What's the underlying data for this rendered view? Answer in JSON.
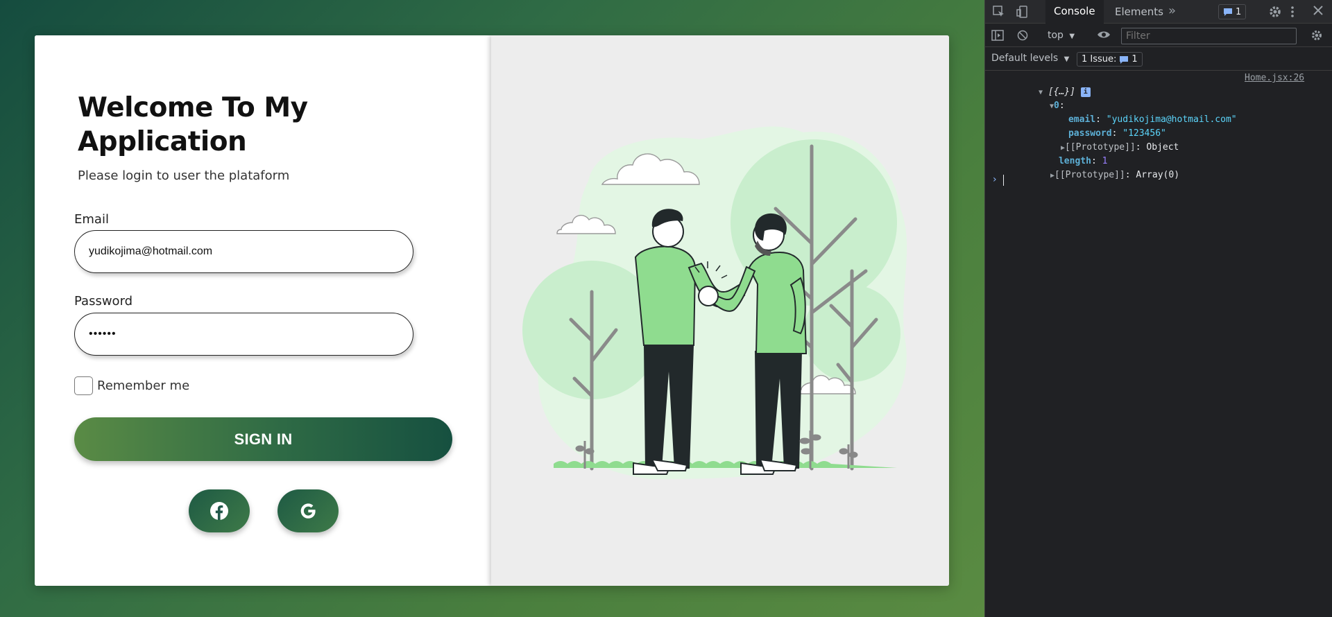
{
  "login": {
    "title": "Welcome To My Application",
    "subtitle": "Please login to user the plataform",
    "email_label": "Email",
    "email_value": "yudikojima@hotmail.com",
    "password_label": "Password",
    "password_value": "••••••",
    "remember_label": "Remember me",
    "remember_checked": false,
    "signin_label": "SIGN IN",
    "social": [
      "facebook-icon",
      "google-icon"
    ],
    "colors": {
      "gradient_start": "#5a8b45",
      "gradient_end": "#165040"
    }
  },
  "devtools": {
    "tabs": [
      "Console",
      "Elements"
    ],
    "active_tab": "Console",
    "more_tabs": "»",
    "message_badge": "1",
    "context": "top",
    "filter_placeholder": "Filter",
    "default_levels": "Default levels",
    "issues_label": "1 Issue:",
    "issues_count": "1",
    "log": {
      "summary": "[{…}]",
      "source": "Home.jsx:26",
      "index": "0",
      "email_key": "email",
      "email_val": "\"yudikojima@hotmail.com\"",
      "password_key": "password",
      "password_val": "\"123456\"",
      "proto_key": "[[Prototype]]",
      "proto_obj": "Object",
      "length_key": "length",
      "length_val": "1",
      "proto_arr": "Array(0)"
    }
  }
}
